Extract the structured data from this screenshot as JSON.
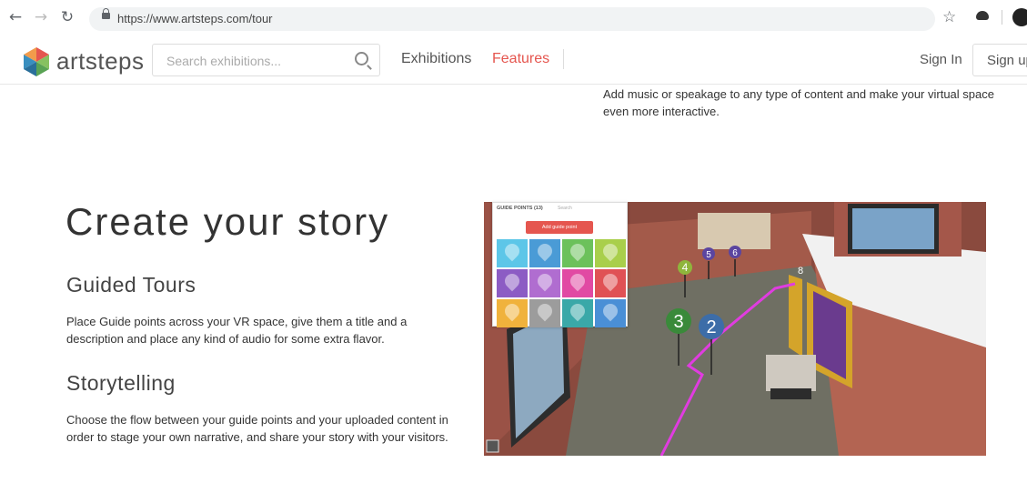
{
  "browser": {
    "back_icon": "arrow-left-icon",
    "forward_icon": "arrow-right-icon",
    "reload_icon": "reload-icon",
    "url": "https://www.artsteps.com/tour"
  },
  "header": {
    "logo_text": "artsteps",
    "search_placeholder": "Search exhibitions...",
    "nav": {
      "exhibitions": "Exhibitions",
      "features": "Features"
    },
    "sign_in": "Sign In",
    "sign_up": "Sign up",
    "accent_color": "#e5564f"
  },
  "content": {
    "intro": "Add music or speakage to any type of content and make your virtual space even more interactive.",
    "heading": "Create your story",
    "sections": [
      {
        "title": "Guided Tours",
        "text": "Place Guide points across your VR space, give them a title and a description and place any kind of audio for some extra flavor."
      },
      {
        "title": "Storytelling",
        "text": "Choose the flow between your guide points and your uploaded content in order to stage your own narrative, and share your story with your visitors."
      }
    ]
  },
  "screenshot": {
    "panel_title": "GUIDE POINTS (13)",
    "search_label": "Search",
    "add_button": "Add guide point",
    "markers": [
      "2",
      "3",
      "4",
      "5",
      "6",
      "8"
    ],
    "tile_colors": [
      "#5dc6e8",
      "#4a9bd6",
      "#6cc15b",
      "#a9cf4b",
      "#8c5cc4",
      "#b06dd0",
      "#e14aa3",
      "#e05155",
      "#f0b23c",
      "#9c9c9c",
      "#3aa8a8",
      "#4a8fd6"
    ]
  }
}
